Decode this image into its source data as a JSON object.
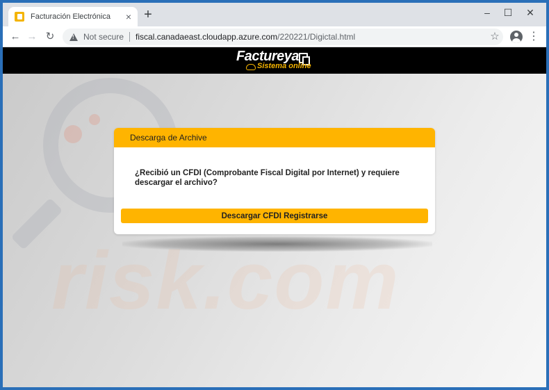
{
  "browser": {
    "tab_title": "Facturación Electrónica",
    "new_tab_symbol": "+",
    "security_label": "Not secure",
    "url_host": "fiscal.canadaeast.cloudapp.azure.com",
    "url_path": "/220221/Digictal.html"
  },
  "site": {
    "brand": "Factureya",
    "tagline": "Sistema online"
  },
  "watermark": {
    "text": "risk.com"
  },
  "dialog": {
    "header": "Descarga de Archive",
    "question": "¿Recibió un CFDI (Comprobante Fiscal Digital por Internet) y requiere descargar el archivo?",
    "button_label": "Descargar CFDI Registrarse"
  },
  "colors": {
    "accent": "#ffb400",
    "header_bg": "#000000"
  },
  "icons": {
    "favicon": "document-icon",
    "back": "arrow-left-icon",
    "forward": "arrow-right-icon",
    "reload": "reload-icon",
    "security": "warning-triangle-icon",
    "bookmark": "star-icon",
    "account": "account-icon",
    "menu": "kebab-menu-icon"
  }
}
